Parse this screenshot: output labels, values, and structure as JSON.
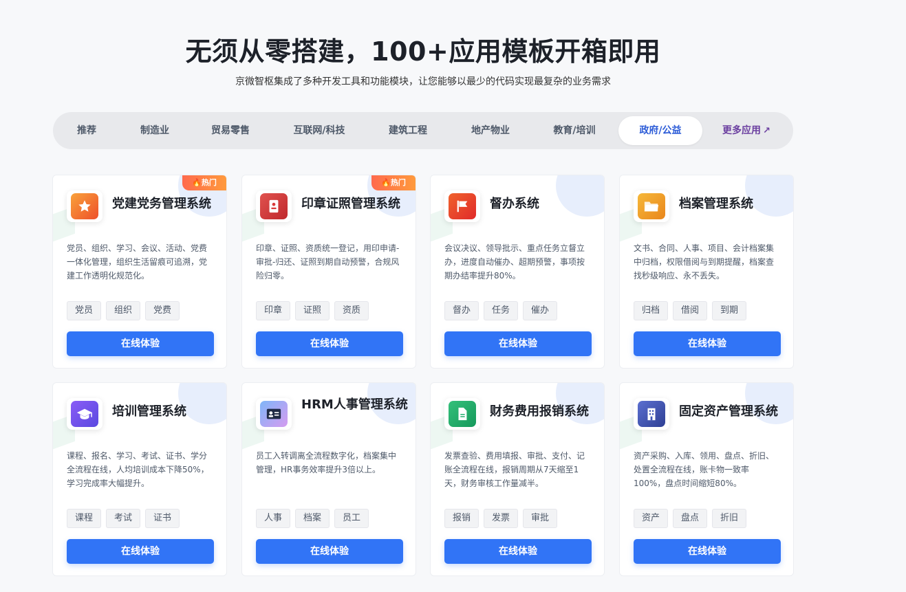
{
  "hero": {
    "title": "无须从零搭建，100+应用模板开箱即用",
    "subtitle": "京微智枢集成了多种开发工具和功能模块，让您能够以最少的代码实现最复杂的业务需求"
  },
  "tabs": [
    {
      "label": "推荐"
    },
    {
      "label": "制造业"
    },
    {
      "label": "贸易零售"
    },
    {
      "label": "互联网/科技"
    },
    {
      "label": "建筑工程"
    },
    {
      "label": "地产物业"
    },
    {
      "label": "教育/培训"
    },
    {
      "label": "政府/公益",
      "active": true
    },
    {
      "label": "更多应用",
      "icon": "arrow-up-right-icon"
    }
  ],
  "hot_label": "🔥热门",
  "cards": [
    {
      "title": "党建党务管理系统",
      "hot": true,
      "icon": "star-icon",
      "icon_color": "#f06a2b",
      "desc": "党员、组织、学习、会议、活动、党费一体化管理，组织生活留痕可追溯，党建工作透明化规范化。",
      "tags": [
        "党员",
        "组织",
        "党费"
      ],
      "button": "在线体验"
    },
    {
      "title": "印章证照管理系统",
      "hot": true,
      "icon": "id-card-icon",
      "icon_color": "#d93a3a",
      "desc": "印章、证照、资质统一登记，用印申请-审批-归还、证照到期自动预警，合规风险归零。",
      "tags": [
        "印章",
        "证照",
        "资质"
      ],
      "button": "在线体验"
    },
    {
      "title": "督办系统",
      "hot": false,
      "icon": "flag-icon",
      "icon_color": "#e8492d",
      "desc": "会议决议、领导批示、重点任务立督立办，进度自动催办、超期预警，事项按期办结率提升80%。",
      "tags": [
        "督办",
        "任务",
        "催办"
      ],
      "button": "在线体验"
    },
    {
      "title": "档案管理系统",
      "hot": false,
      "icon": "folder-icon",
      "icon_color": "#f0a12a",
      "desc": "文书、合同、人事、项目、会计档案集中归档，权限借阅与到期提醒，档案查找秒级响应、永不丢失。",
      "tags": [
        "归档",
        "借阅",
        "到期"
      ],
      "button": "在线体验"
    },
    {
      "title": "培训管理系统",
      "hot": false,
      "icon": "graduation-cap-icon",
      "icon_color": "#6c4ee8",
      "desc": "课程、报名、学习、考试、证书、学分全流程在线，人均培训成本下降50%，学习完成率大幅提升。",
      "tags": [
        "课程",
        "考试",
        "证书"
      ],
      "button": "在线体验"
    },
    {
      "title": "HRM人事管理系统",
      "hot": false,
      "icon": "contact-card-icon",
      "icon_color": "#8e9bf0",
      "desc": "员工入转调离全流程数字化，档案集中管理，HR事务效率提升3倍以上。",
      "tags": [
        "人事",
        "档案",
        "员工"
      ],
      "button": "在线体验"
    },
    {
      "title": "财务费用报销系统",
      "hot": false,
      "icon": "document-icon",
      "icon_color": "#1fae6b",
      "desc": "发票查验、费用填报、审批、支付、记账全流程在线，报销周期从7天缩至1天，财务审核工作量减半。",
      "tags": [
        "报销",
        "发票",
        "审批"
      ],
      "button": "在线体验"
    },
    {
      "title": "固定资产管理系统",
      "hot": false,
      "icon": "building-icon",
      "icon_color": "#3f57b8",
      "desc": "资产采购、入库、领用、盘点、折旧、处置全流程在线，账卡物一致率100%，盘点时间缩短80%。",
      "tags": [
        "资产",
        "盘点",
        "折旧"
      ],
      "button": "在线体验"
    }
  ]
}
